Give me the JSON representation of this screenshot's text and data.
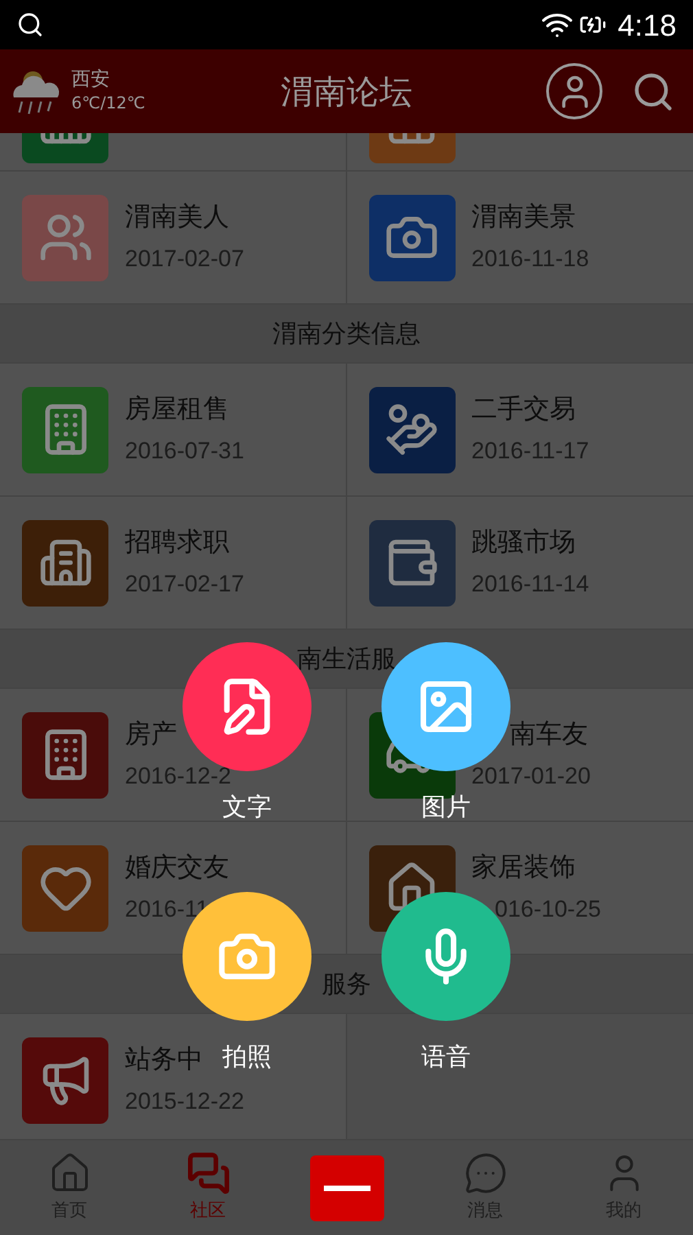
{
  "status_bar": {
    "time": "4:18"
  },
  "header": {
    "city": "西安",
    "temperature": "6℃/12℃",
    "title": "渭南论坛"
  },
  "sections": [
    {
      "items": [
        {
          "color": "#0a4a20"
        },
        {
          "color": "#6e3a14"
        }
      ]
    },
    {
      "items": [
        {
          "title": "渭南美人",
          "date": "2017-02-07",
          "color": "#7a4848"
        },
        {
          "title": "渭南美景",
          "date": "2016-11-18",
          "color": "#0e2f66"
        }
      ]
    },
    {
      "title": "渭南分类信息",
      "items": [
        {
          "title": "房屋租售",
          "date": "2016-07-31",
          "color": "#1f5a1f"
        },
        {
          "title": "二手交易",
          "date": "2016-11-17",
          "color": "#0a1f44"
        },
        {
          "title": "招聘求职",
          "date": "2017-02-17",
          "color": "#3d1f08"
        },
        {
          "title": "跳骚市场",
          "date": "2016-11-14",
          "color": "#1f2c40"
        }
      ]
    },
    {
      "title": "南生活服",
      "items": [
        {
          "title": "房产",
          "date": "2016-12-2",
          "color": "#4a0c0a"
        },
        {
          "title": "南车友",
          "date": "2017-01-20",
          "color": "#0a3a0a"
        },
        {
          "title": "婚庆交友",
          "date": "2016-11",
          "color": "#5a2a0a"
        },
        {
          "title": "家居装饰",
          "date": "016-10-25",
          "color": "#3a200c"
        }
      ]
    },
    {
      "title": "服务",
      "items": [
        {
          "title": "站务中",
          "date": "2015-12-22",
          "color": "#550a0a"
        }
      ]
    }
  ],
  "actions": [
    {
      "label": "文字",
      "color": "#ff2d55"
    },
    {
      "label": "图片",
      "color": "#4dbfff"
    },
    {
      "label": "拍照",
      "color": "#ffc03a"
    },
    {
      "label": "语音",
      "color": "#20bb8e"
    }
  ],
  "nav": [
    {
      "label": "首页",
      "selected": false
    },
    {
      "label": "社区",
      "selected": true
    },
    {
      "kind": "add"
    },
    {
      "label": "消息",
      "selected": false
    },
    {
      "label": "我的",
      "selected": false
    }
  ]
}
